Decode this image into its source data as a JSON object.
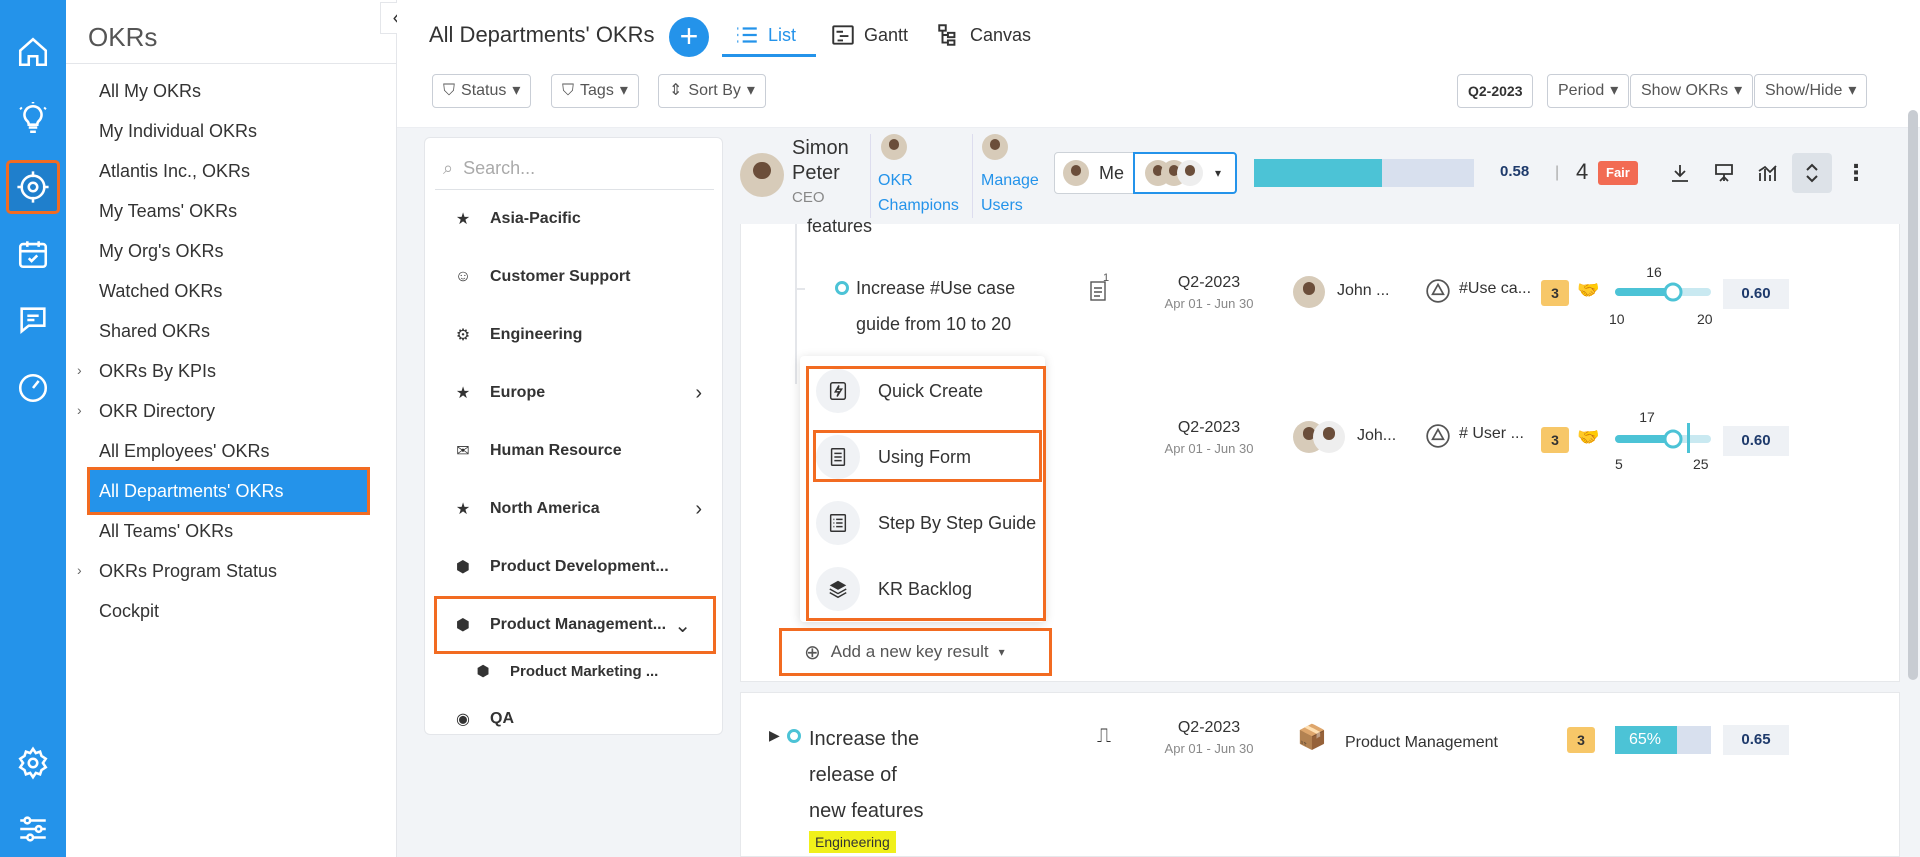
{
  "sidebar": {
    "title": "OKRs",
    "items": [
      {
        "label": "All My OKRs",
        "caret": false
      },
      {
        "label": "My Individual OKRs",
        "caret": false
      },
      {
        "label": "Atlantis Inc., OKRs",
        "caret": false
      },
      {
        "label": "My Teams' OKRs",
        "caret": false
      },
      {
        "label": "My Org's OKRs",
        "caret": false
      },
      {
        "label": "Watched OKRs",
        "caret": false
      },
      {
        "label": "Shared OKRs",
        "caret": false
      },
      {
        "label": "OKRs By KPIs",
        "caret": true
      },
      {
        "label": "OKR Directory",
        "caret": true
      },
      {
        "label": "All Employees' OKRs",
        "caret": false
      },
      {
        "label": "All Departments' OKRs",
        "caret": false,
        "active": true
      },
      {
        "label": "All Teams' OKRs",
        "caret": false
      },
      {
        "label": "OKRs Program Status",
        "caret": true
      },
      {
        "label": "Cockpit",
        "caret": false
      }
    ]
  },
  "header": {
    "title": "All Departments' OKRs",
    "tabs": [
      {
        "label": "List",
        "icon": "list-icon",
        "active": true
      },
      {
        "label": "Gantt",
        "icon": "gantt-icon"
      },
      {
        "label": "Canvas",
        "icon": "canvas-icon"
      }
    ],
    "filters": {
      "status": "Status",
      "tags": "Tags",
      "sort": "Sort By"
    },
    "right_filters": {
      "quarter": "Q2-2023",
      "period": "Period",
      "show_okrs": "Show OKRs",
      "show_hide": "Show/Hide"
    }
  },
  "departments": {
    "search_placeholder": "Search...",
    "items": [
      {
        "label": "Asia-Pacific",
        "icon": "star-icon",
        "chevron": false
      },
      {
        "label": "Customer Support",
        "icon": "avatar-icon",
        "chevron": false
      },
      {
        "label": "Engineering",
        "icon": "gear-icon",
        "chevron": false
      },
      {
        "label": "Europe",
        "icon": "star-icon",
        "chevron": true
      },
      {
        "label": "Human Resource",
        "icon": "envelope-icon",
        "chevron": false
      },
      {
        "label": "North America",
        "icon": "star-icon",
        "chevron": true
      },
      {
        "label": "Product Development...",
        "icon": "box-icon",
        "chevron": false
      },
      {
        "label": "Product Management...",
        "icon": "box-icon",
        "chevron": true,
        "active": true
      },
      {
        "label": "Product Marketing ...",
        "icon": "box-icon",
        "chevron": false,
        "sub": true
      },
      {
        "label": "QA",
        "icon": "qa-icon",
        "chevron": false
      }
    ]
  },
  "userbar": {
    "name_line1": "Simon",
    "name_line2": "Peter",
    "role": "CEO",
    "champions_line1": "OKR",
    "champions_line2": "Champions",
    "manage_line1": "Manage",
    "manage_line2": "Users",
    "me_label": "Me",
    "progress_value": "0.58",
    "progress_fraction": 0.58,
    "count": "4",
    "status": "Fair",
    "colors": {
      "fair": "#f26b53",
      "progress": "#4cc3d6",
      "track": "#d8e0ee"
    }
  },
  "key_results": [
    {
      "title_line1": "Increase #Use case",
      "title_line2": "guide from 10 to 20",
      "doc_count": "1",
      "quarter": "Q2-2023",
      "dates": "Apr 01 - Jun 30",
      "owner": "John ...",
      "tag": "#Use ca...",
      "badge": "3",
      "slider": {
        "min": "10",
        "max": "20",
        "current": "16",
        "fraction": 0.6
      },
      "score": "0.60"
    },
    {
      "title_line1": "",
      "title_line2": "",
      "quarter": "Q2-2023",
      "dates": "Apr 01 - Jun 30",
      "owner": "Joh...",
      "tag": "# User ...",
      "badge": "3",
      "slider": {
        "min": "5",
        "max": "25",
        "current": "17",
        "fraction": 0.6
      },
      "score": "0.60"
    }
  ],
  "partial_heading": "features",
  "add_menu": {
    "items": [
      {
        "label": "Quick Create",
        "icon": "bolt-icon"
      },
      {
        "label": "Using Form",
        "icon": "form-icon"
      },
      {
        "label": "Step By Step Guide",
        "icon": "checklist-icon"
      },
      {
        "label": "KR Backlog",
        "icon": "layers-icon"
      }
    ],
    "add_label": "Add a new key result"
  },
  "objective": {
    "title_line1": "Increase the",
    "title_line2": "release of",
    "title_line3": "new features",
    "quarter": "Q2-2023",
    "dates": "Apr 01 - Jun 30",
    "owner": "Product Management",
    "badge": "3",
    "progress_label": "65%",
    "progress_fraction": 0.65,
    "score": "0.65",
    "tag": "Engineering"
  }
}
